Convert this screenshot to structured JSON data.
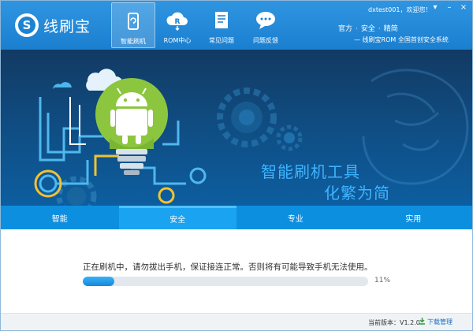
{
  "app": {
    "name": "线刷宝",
    "logo_letter": "S"
  },
  "nav": [
    {
      "label": "智能刷机",
      "icon": "refresh-phone-icon",
      "active": true
    },
    {
      "label": "ROM中心",
      "icon": "cloud-rom-icon",
      "active": false
    },
    {
      "label": "常见问题",
      "icon": "document-icon",
      "active": false
    },
    {
      "label": "问题反馈",
      "icon": "chat-bubble-icon",
      "active": false
    }
  ],
  "user": {
    "greeting": "dxtest001，欢迎您！"
  },
  "links": {
    "items": [
      "官方",
      "安全",
      "精简"
    ]
  },
  "slogan": "— 线刷宝ROM 全国首创安全系统",
  "banner": {
    "title_line1": "智能刷机工具",
    "title_line2": "化繁为简"
  },
  "tabs": [
    {
      "label": "智能",
      "active": false
    },
    {
      "label": "安全",
      "active": true
    },
    {
      "label": "专业",
      "active": false
    },
    {
      "label": "实用",
      "active": false
    }
  ],
  "flash": {
    "status_text": "正在刷机中，请勿拔出手机，保证接连正常。否则将有可能导致手机无法使用。",
    "progress_percent": 11,
    "progress_label": "11%"
  },
  "footer": {
    "version_label": "当前版本：V1.2.0",
    "download_label": "下载管理"
  },
  "colors": {
    "titlebar": "#1b7fd0",
    "accent": "#1aa3f0",
    "banner_text": "#3fb4ff",
    "bulb": "#8cc63f"
  }
}
